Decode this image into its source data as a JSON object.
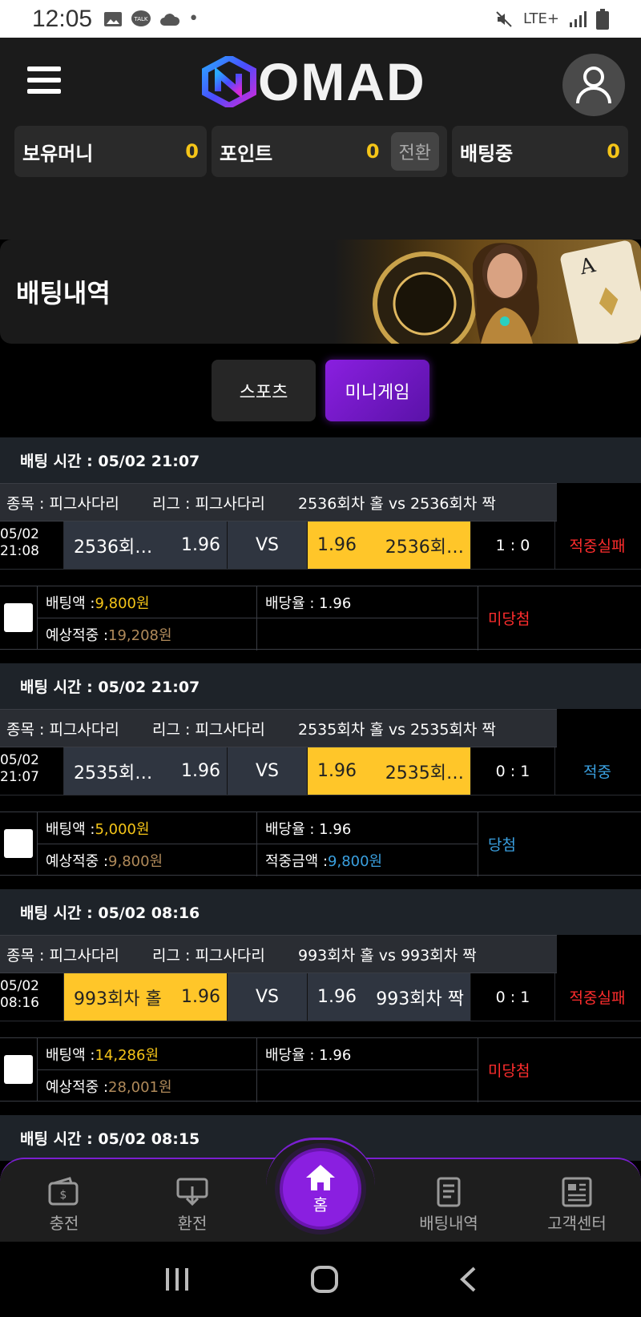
{
  "status_bar": {
    "time": "12:05",
    "network": "LTE+"
  },
  "header": {
    "logo_text": "OMAD",
    "balances": [
      {
        "label": "보유머니",
        "value": "0"
      },
      {
        "label": "포인트",
        "value": "0",
        "action": "전환"
      },
      {
        "label": "배팅중",
        "value": "0"
      }
    ]
  },
  "banner": {
    "title": "배팅내역"
  },
  "tabs": [
    {
      "label": "스포츠",
      "active": false
    },
    {
      "label": "미니게임",
      "active": true
    }
  ],
  "bets": [
    {
      "time_label": "배팅 시간 : 05/02 21:07",
      "sport": "종목 : 피그사다리",
      "league": "리그 : 피그사다리",
      "matchup": "2536회차 홀  vs  2536회차 짝",
      "date": "05/02",
      "clock": "21:08",
      "home_name": "2536회…",
      "home_odd": "1.96",
      "vs": "VS",
      "away_odd": "1.96",
      "away_name": "2536회…",
      "selected": "away",
      "score": "1 : 0",
      "result": "적중실패",
      "bet_amount_label": "배팅액 : ",
      "bet_amount": "9,800원",
      "odds_label": "배당율 : 1.96",
      "expected_label": "예상적중 : ",
      "expected": "19,208원",
      "win_label": "",
      "win_amount": "",
      "status": "미당첨"
    },
    {
      "time_label": "배팅 시간 : 05/02 21:07",
      "sport": "종목 : 피그사다리",
      "league": "리그 : 피그사다리",
      "matchup": "2535회차 홀  vs  2535회차 짝",
      "date": "05/02",
      "clock": "21:07",
      "home_name": "2535회…",
      "home_odd": "1.96",
      "vs": "VS",
      "away_odd": "1.96",
      "away_name": "2535회…",
      "selected": "away",
      "score": "0 : 1",
      "result": "적중",
      "bet_amount_label": "배팅액 : ",
      "bet_amount": "5,000원",
      "odds_label": "배당율 : 1.96",
      "expected_label": "예상적중 : ",
      "expected": "9,800원",
      "win_label": "적중금액 : ",
      "win_amount": "9,800원",
      "status": "당첨"
    },
    {
      "time_label": "배팅 시간 : 05/02 08:16",
      "sport": "종목 : 피그사다리",
      "league": "리그 : 피그사다리",
      "matchup": "993회차 홀  vs  993회차 짝",
      "date": "05/02",
      "clock": "08:16",
      "home_name": "993회차 홀",
      "home_odd": "1.96",
      "vs": "VS",
      "away_odd": "1.96",
      "away_name": "993회차 짝",
      "selected": "home",
      "score": "0 : 1",
      "result": "적중실패",
      "bet_amount_label": "배팅액 : ",
      "bet_amount": "14,286원",
      "odds_label": "배당율 : 1.96",
      "expected_label": "예상적중 : ",
      "expected": "28,001원",
      "win_label": "",
      "win_amount": "",
      "status": "미당첨"
    }
  ],
  "partial_bet_time": "배팅 시간 : 05/02 08:15",
  "bottom_nav": {
    "charge": "충전",
    "exchange": "환전",
    "home": "홈",
    "history": "배팅내역",
    "support": "고객센터"
  },
  "colors": {
    "accent_purple": "#8a1fe0",
    "selected_yellow": "#ffc629",
    "loss_red": "#ff2d2d",
    "win_blue": "#3aa0e0",
    "money_gold": "#f5c518"
  }
}
